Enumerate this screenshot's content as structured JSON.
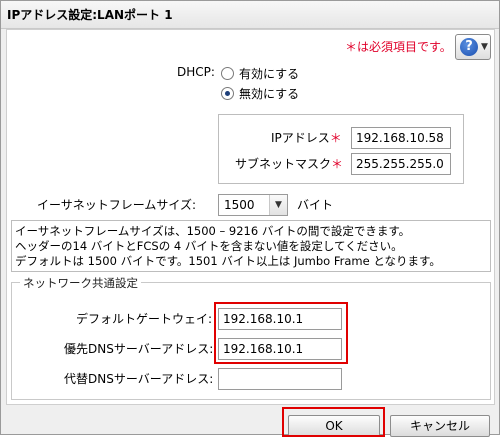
{
  "window": {
    "title": "IPアドレス設定:LANポート 1"
  },
  "header": {
    "required_note": "＊は必須項目です。",
    "help_symbol": "?"
  },
  "dhcp": {
    "label": "DHCP:",
    "options": [
      {
        "label": "有効にする",
        "selected": false
      },
      {
        "label": "無効にする",
        "selected": true
      }
    ]
  },
  "ip": {
    "address_label": "IPアドレス",
    "address_value": "192.168.10.58",
    "subnet_label": "サブネットマスク",
    "subnet_value": "255.255.255.0",
    "required_mark": "＊"
  },
  "frame": {
    "label": "イーサネットフレームサイズ:",
    "selected": "1500",
    "unit": "バイト",
    "info_lines": [
      "イーサネットフレームサイズは、1500 – 9216 バイトの間で設定できます。",
      "ヘッダーの14 バイトとFCSの 4 バイトを含まない値を設定してください。",
      "デフォルトは 1500 バイトです。1501 バイト以上は Jumbo Frame となります。"
    ]
  },
  "network_common": {
    "legend": "ネットワーク共通設定",
    "gateway_label": "デフォルトゲートウェイ:",
    "gateway_value": "192.168.10.1",
    "dns_primary_label": "優先DNSサーバーアドレス:",
    "dns_primary_value": "192.168.10.1",
    "dns_secondary_label": "代替DNSサーバーアドレス:",
    "dns_secondary_value": ""
  },
  "buttons": {
    "ok": "OK",
    "cancel": "キャンセル"
  },
  "colors": {
    "required": "#e0002a",
    "highlight": "#e00000",
    "help_blue": "#1a4fb0"
  }
}
